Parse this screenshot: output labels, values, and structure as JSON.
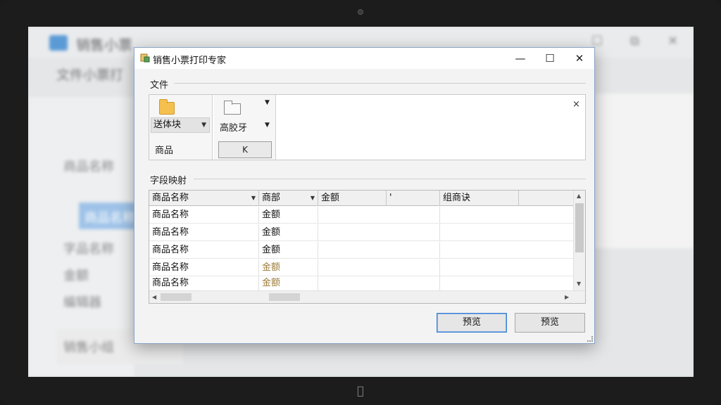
{
  "dialog": {
    "title": "销售小票打印专家",
    "controls": {
      "minimize": "—",
      "maximize": "☐",
      "close": "✕"
    }
  },
  "file_section": {
    "label": "文件",
    "card1": {
      "combo_value": "送体块",
      "secondary_label": "商品"
    },
    "card2": {
      "combo_value": "高胶牙",
      "button_label": "K"
    },
    "close_label": "×"
  },
  "mapping_section": {
    "label": "字段映射",
    "columns": [
      "商品名称",
      "商部",
      "金额",
      "'",
      "组商诀",
      ""
    ],
    "rows": [
      [
        "商品名称",
        "金额",
        "",
        "",
        ""
      ],
      [
        "商品名称",
        "金额",
        "",
        "",
        ""
      ],
      [
        "商品名称",
        "金额",
        "",
        "",
        ""
      ],
      [
        "商品名称",
        "金额",
        "",
        "",
        ""
      ],
      [
        "商品名称",
        "金额",
        "",
        "",
        ""
      ]
    ]
  },
  "footer": {
    "preview_button_1": "预览",
    "preview_button_2": "预览"
  },
  "background_app": {
    "title": "销售小票",
    "subtitle": "文件小票打",
    "side_items": [
      "商品名称",
      "商品名称",
      "字品名称",
      "金额",
      "编辑器",
      "销售小组"
    ]
  },
  "colors": {
    "accent": "#3c7fd1",
    "folder": "#f5c04e",
    "muted_value": "#9a7b3a"
  }
}
